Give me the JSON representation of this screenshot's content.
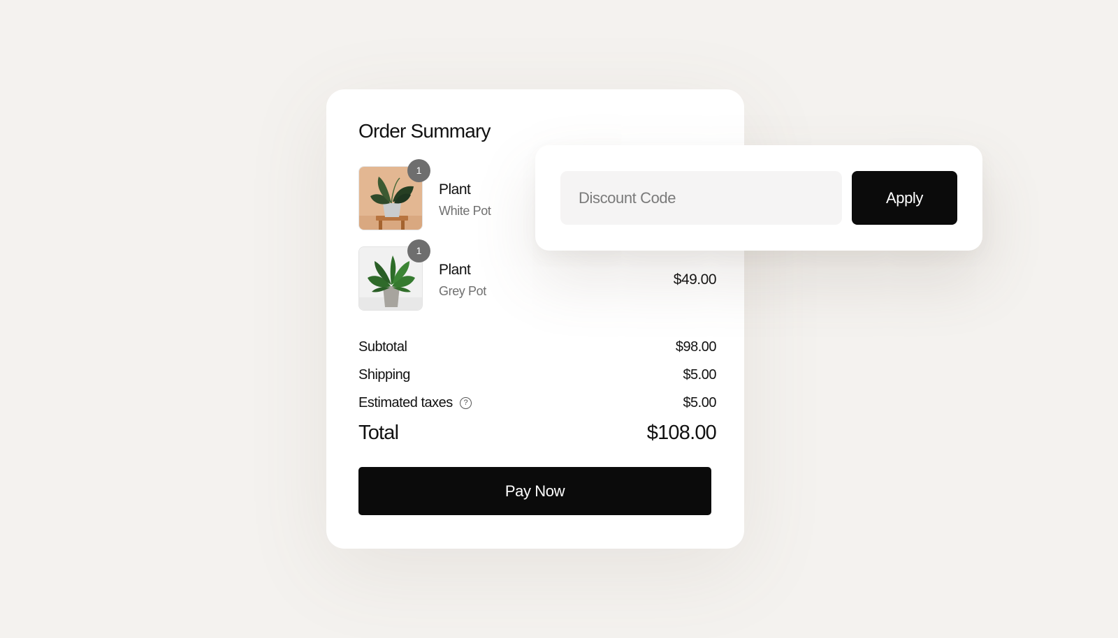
{
  "order_summary": {
    "title": "Order Summary",
    "items": [
      {
        "name": "Plant",
        "variant": "White Pot",
        "quantity": "1",
        "price": ""
      },
      {
        "name": "Plant",
        "variant": "Grey Pot",
        "quantity": "1",
        "price": "$49.00"
      }
    ],
    "subtotal": {
      "label": "Subtotal",
      "value": "$98.00"
    },
    "shipping": {
      "label": "Shipping",
      "value": "$5.00"
    },
    "taxes": {
      "label": "Estimated taxes",
      "value": "$5.00",
      "icon": "help-circle-icon"
    },
    "total": {
      "label": "Total",
      "value": "$108.00"
    },
    "pay_button": "Pay Now"
  },
  "discount": {
    "placeholder": "Discount Code",
    "value": "",
    "apply_button": "Apply"
  },
  "colors": {
    "background": "#f4f2ef",
    "card": "#ffffff",
    "button": "#0b0b0b",
    "badge": "#6e6e6e"
  }
}
